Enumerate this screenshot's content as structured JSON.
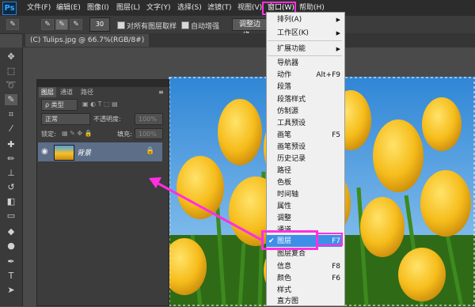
{
  "app": {
    "logo": "Ps"
  },
  "menubar": {
    "items": [
      "文件(F)",
      "编辑(E)",
      "图像(I)",
      "图层(L)",
      "文字(Y)",
      "选择(S)",
      "滤镜(T)",
      "视图(V)",
      "窗口(W)",
      "帮助(H)"
    ]
  },
  "options": {
    "brush_size": "30",
    "sample_all_layers": "对所有图层取样",
    "auto_enhance": "自动增强",
    "refine_edge": "调整边缘..."
  },
  "document": {
    "tab_title": "(C) Tulips.jpg @ 66.7%(RGB/8#)"
  },
  "layers_panel": {
    "tabs": [
      "图层",
      "通道",
      "路径"
    ],
    "filter_label": "ρ 类型",
    "blend_mode": "正常",
    "opacity_label": "不透明度:",
    "opacity_value": "100%",
    "lock_label": "锁定:",
    "fill_label": "填充:",
    "fill_value": "100%",
    "layer_name": "背景"
  },
  "window_menu": {
    "items": [
      {
        "label": "排列(A)",
        "key": "",
        "submenu": true
      },
      {
        "label": "工作区(K)",
        "key": "",
        "submenu": true
      },
      {
        "label": "扩展功能",
        "key": "",
        "submenu": true
      },
      {
        "label": "导航器",
        "key": ""
      },
      {
        "label": "动作",
        "key": "Alt+F9"
      },
      {
        "label": "段落",
        "key": ""
      },
      {
        "label": "段落样式",
        "key": ""
      },
      {
        "label": "仿制源",
        "key": ""
      },
      {
        "label": "工具预设",
        "key": ""
      },
      {
        "label": "画笔",
        "key": "F5"
      },
      {
        "label": "画笔预设",
        "key": ""
      },
      {
        "label": "历史记录",
        "key": ""
      },
      {
        "label": "路径",
        "key": ""
      },
      {
        "label": "色板",
        "key": ""
      },
      {
        "label": "时间轴",
        "key": ""
      },
      {
        "label": "属性",
        "key": ""
      },
      {
        "label": "调整",
        "key": ""
      },
      {
        "label": "通道",
        "key": ""
      },
      {
        "label": "图层",
        "key": "F7",
        "checked": true
      },
      {
        "label": "图层复合",
        "key": ""
      },
      {
        "label": "信息",
        "key": "F8"
      },
      {
        "label": "颜色",
        "key": "F6"
      },
      {
        "label": "样式",
        "key": ""
      },
      {
        "label": "直方图",
        "key": ""
      }
    ]
  },
  "colors": {
    "accent": "#ff2fe0",
    "highlight": "#3d8fe8",
    "selected_layer": "#5c6e88"
  }
}
